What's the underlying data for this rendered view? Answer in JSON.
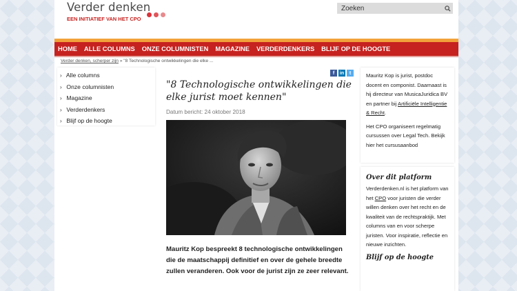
{
  "header": {
    "logo_title": "Verder denken",
    "logo_subtitle": "EEN INITIATIEF VAN HET CPO",
    "dot_colors": [
      "#d9333b",
      "#e0565b",
      "#e88a8d"
    ]
  },
  "search": {
    "placeholder": "Zoeken",
    "icon": "search-icon"
  },
  "nav": {
    "items": [
      "HOME",
      "ALLE COLUMNS",
      "ONZE COLUMNISTEN",
      "MAGAZINE",
      "VERDERDENKERS",
      "BLIJF OP DE HOOGTE"
    ]
  },
  "breadcrumb": {
    "link": "Verder denken, scherper zijn",
    "separator": "»",
    "current": "\"8 Technologische ontwikkelingen die elke ..."
  },
  "sidebar": {
    "items": [
      "Alle columns",
      "Onze columnisten",
      "Magazine",
      "Verderdenkers",
      "Blijf op de hoogte"
    ]
  },
  "article": {
    "share": [
      "f",
      "in",
      "t"
    ],
    "title": "\"8 Technologische ontwikkelingen die elke jurist moet kennen\"",
    "date": "Datum bericht: 24 oktober 2018",
    "lead": "Mauritz Kop bespreekt 8 technologische ontwikkelingen die de maatschappij definitief en over de gehele breedte zullen veranderen. Ook voor de jurist zijn ze zeer relevant."
  },
  "right_author": {
    "text_before": "Mauritz Kop is jurist, postdoc docent en componist. Daarnaast is hij directeur van MusicaJuridica BV en partner bij ",
    "link": "Artificiële Intelligentie & Recht",
    "text_after": ".",
    "para2": "Het CPO organiseert regelmatig cursussen over Legal Tech. Bekijk hier het cursusaanbod"
  },
  "right_platform": {
    "heading": "Over dit platform",
    "text_before": "Verderdenken.nl is het platform van het ",
    "link": "CPO",
    "text_after": " voor juristen die verder willen denken over het recht en de kwaliteit van de rechtspraktijk. Met columns van en voor scherpe juristen. Voor inspiratie, reflectie en nieuwe inzichten.",
    "heading2": "Blijf op de hoogte"
  },
  "colors": {
    "brand_red": "#c6221f",
    "nav_stripe": "#f2a23a",
    "facebook": "#3b5998",
    "linkedin": "#0077b5",
    "twitter": "#55acee"
  }
}
